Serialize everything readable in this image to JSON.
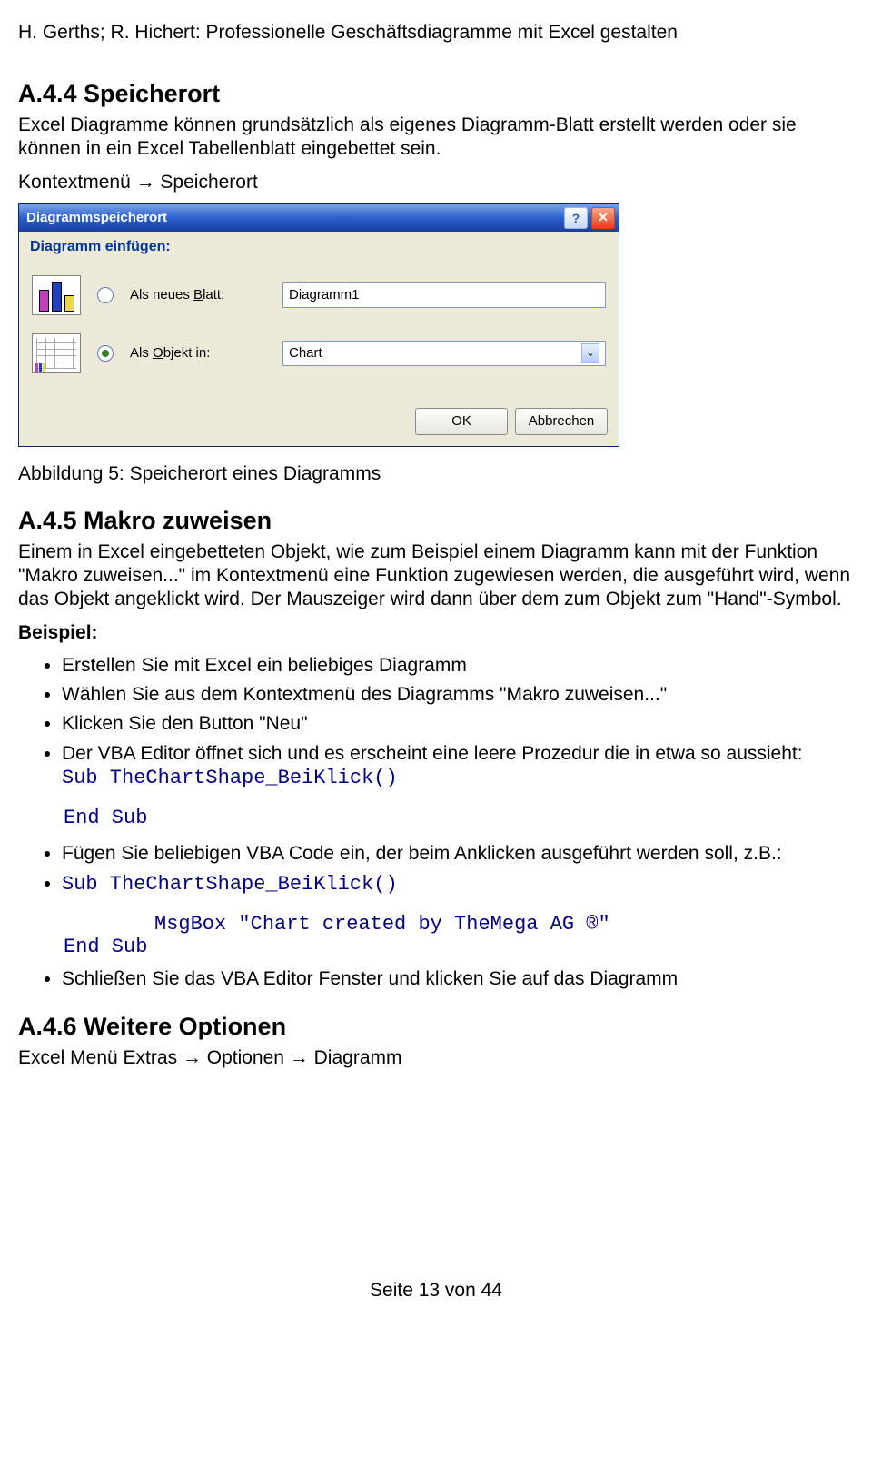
{
  "doc": {
    "header": "H. Gerths; R. Hichert: Professionelle Geschäftsdiagramme mit Excel gestalten",
    "sec44_title": "A.4.4 Speicherort",
    "sec44_p": "Excel Diagramme können grundsätzlich als eigenes Diagramm-Blatt erstellt werden oder sie können in ein Excel Tabellenblatt eingebettet sein.",
    "sec44_path": "Kontextmenü → Speicherort",
    "caption5": "Abbildung 5: Speicherort eines Diagramms",
    "sec45_title": "A.4.5 Makro zuweisen",
    "sec45_p": "Einem in Excel eingebetteten Objekt, wie zum Beispiel einem Diagramm kann mit der Funktion \"Makro zuweisen...\" im Kontextmenü eine Funktion zugewiesen werden, die ausgeführt wird, wenn das Objekt angeklickt wird. Der Mauszeiger wird dann über dem zum Objekt zum \"Hand\"-Symbol.",
    "beispiel": "Beispiel:",
    "b1": "Erstellen Sie mit Excel ein beliebiges Diagramm",
    "b2": "Wählen Sie aus dem Kontextmenü des Diagramms \"Makro zuweisen...\"",
    "b3": "Klicken Sie den Button \"Neu\"",
    "b4": "Der VBA Editor öffnet sich und es erscheint eine leere Prozedur die in etwa so aussieht:",
    "code4a": "Sub TheChartShape_BeiKlick()",
    "code4b": "End Sub",
    "b5": "Fügen Sie beliebigen VBA Code ein, der beim Anklicken ausgeführt werden soll, z.B.:",
    "code5a": "Sub TheChartShape_BeiKlick()",
    "code5b": "MsgBox \"Chart created by TheMega AG ®\"",
    "code5c": "End Sub",
    "b6": "Schließen Sie das VBA Editor Fenster und klicken Sie auf das Diagramm",
    "sec46_title": "A.4.6 Weitere Optionen",
    "sec46_path": "Excel Menü Extras → Optionen → Diagramm",
    "footer": "Seite 13 von 44"
  },
  "dialog": {
    "title": "Diagrammspeicherort",
    "subtitle": "Diagramm einfügen:",
    "opt1_prefix": "Als neues ",
    "opt1_u": "B",
    "opt1_suffix": "latt:",
    "field1": "Diagramm1",
    "opt2_prefix": "Als ",
    "opt2_u": "O",
    "opt2_suffix": "bjekt in:",
    "field2": "Chart",
    "ok": "OK",
    "cancel": "Abbrechen"
  }
}
